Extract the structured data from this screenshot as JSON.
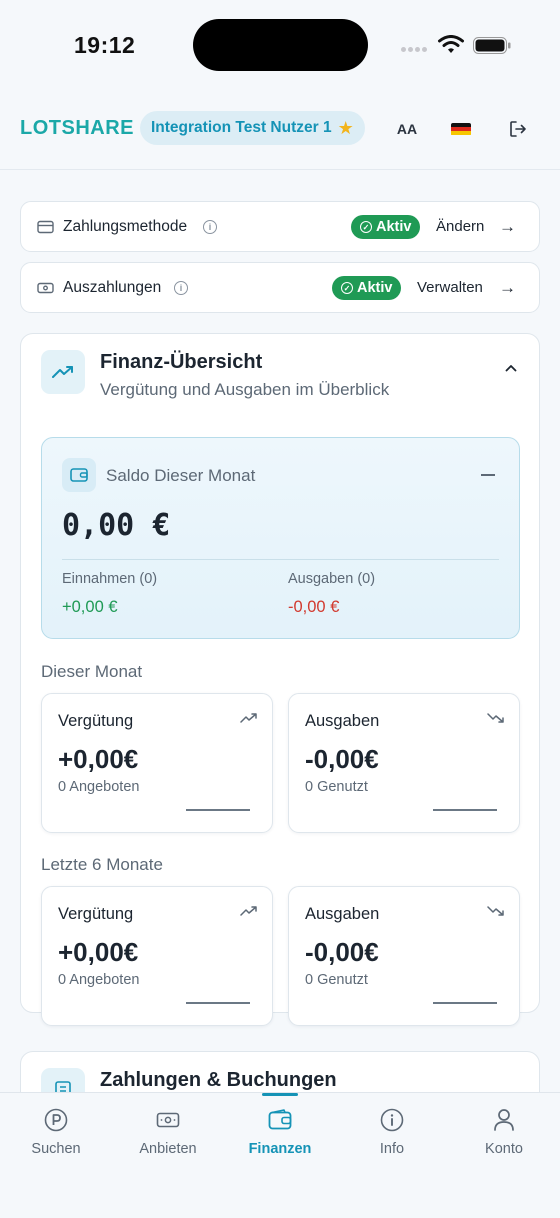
{
  "status_bar": {
    "time": "19:12"
  },
  "header": {
    "logo": "LOTSHARE",
    "user_name": "Integration Test Nutzer 1",
    "font_button": "AA"
  },
  "payment_method": {
    "label": "Zahlungsmethode",
    "status": "Aktiv",
    "action": "Ändern"
  },
  "payouts": {
    "label": "Auszahlungen",
    "status": "Aktiv",
    "action": "Verwalten"
  },
  "finance_overview": {
    "title": "Finanz-Übersicht",
    "subtitle": "Vergütung und Ausgaben im Überblick",
    "balance": {
      "label": "Saldo Dieser Monat",
      "amount": "0,00 €",
      "income_label": "Einnahmen (0)",
      "income_value": "+0,00 €",
      "expense_label": "Ausgaben (0)",
      "expense_value": "-0,00 €"
    },
    "this_month": {
      "label": "Dieser Monat",
      "compensation": {
        "title": "Vergütung",
        "value": "+0,00€",
        "sub": "0 Angeboten"
      },
      "expenses": {
        "title": "Ausgaben",
        "value": "-0,00€",
        "sub": "0 Genutzt"
      }
    },
    "last_6_months": {
      "label": "Letzte 6 Monate",
      "compensation": {
        "title": "Vergütung",
        "value": "+0,00€",
        "sub": "0 Angeboten"
      },
      "expenses": {
        "title": "Ausgaben",
        "value": "-0,00€",
        "sub": "0 Genutzt"
      }
    }
  },
  "payments_bookings": {
    "title": "Zahlungen & Buchungen"
  },
  "tabs": [
    {
      "label": "Suchen",
      "icon": "parking-icon"
    },
    {
      "label": "Anbieten",
      "icon": "cash-icon"
    },
    {
      "label": "Finanzen",
      "icon": "wallet-icon",
      "active": true
    },
    {
      "label": "Info",
      "icon": "info-icon"
    },
    {
      "label": "Konto",
      "icon": "user-icon"
    }
  ],
  "colors": {
    "accent": "#1593b6",
    "logo": "#1ba8a8",
    "success": "#1f9a55",
    "income": "#1f9a55",
    "expense": "#d23a2f"
  }
}
